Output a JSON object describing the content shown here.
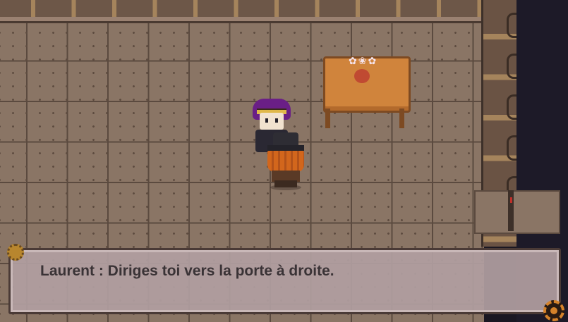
{
  "game": {
    "dialog": {
      "speaker": "Laurent",
      "text": "Laurent : Diriges toi vers la porte à droite."
    },
    "colors": {
      "floor": "#8a7565",
      "dialog_box": "#b09ea0",
      "table": "#d0843c",
      "npc_hair": "#6a1f86",
      "hero_hair": "#d2661c",
      "door_marker": "#c0302a"
    },
    "icons": [
      "corner-gear-icon",
      "settings-gear-icon"
    ]
  }
}
